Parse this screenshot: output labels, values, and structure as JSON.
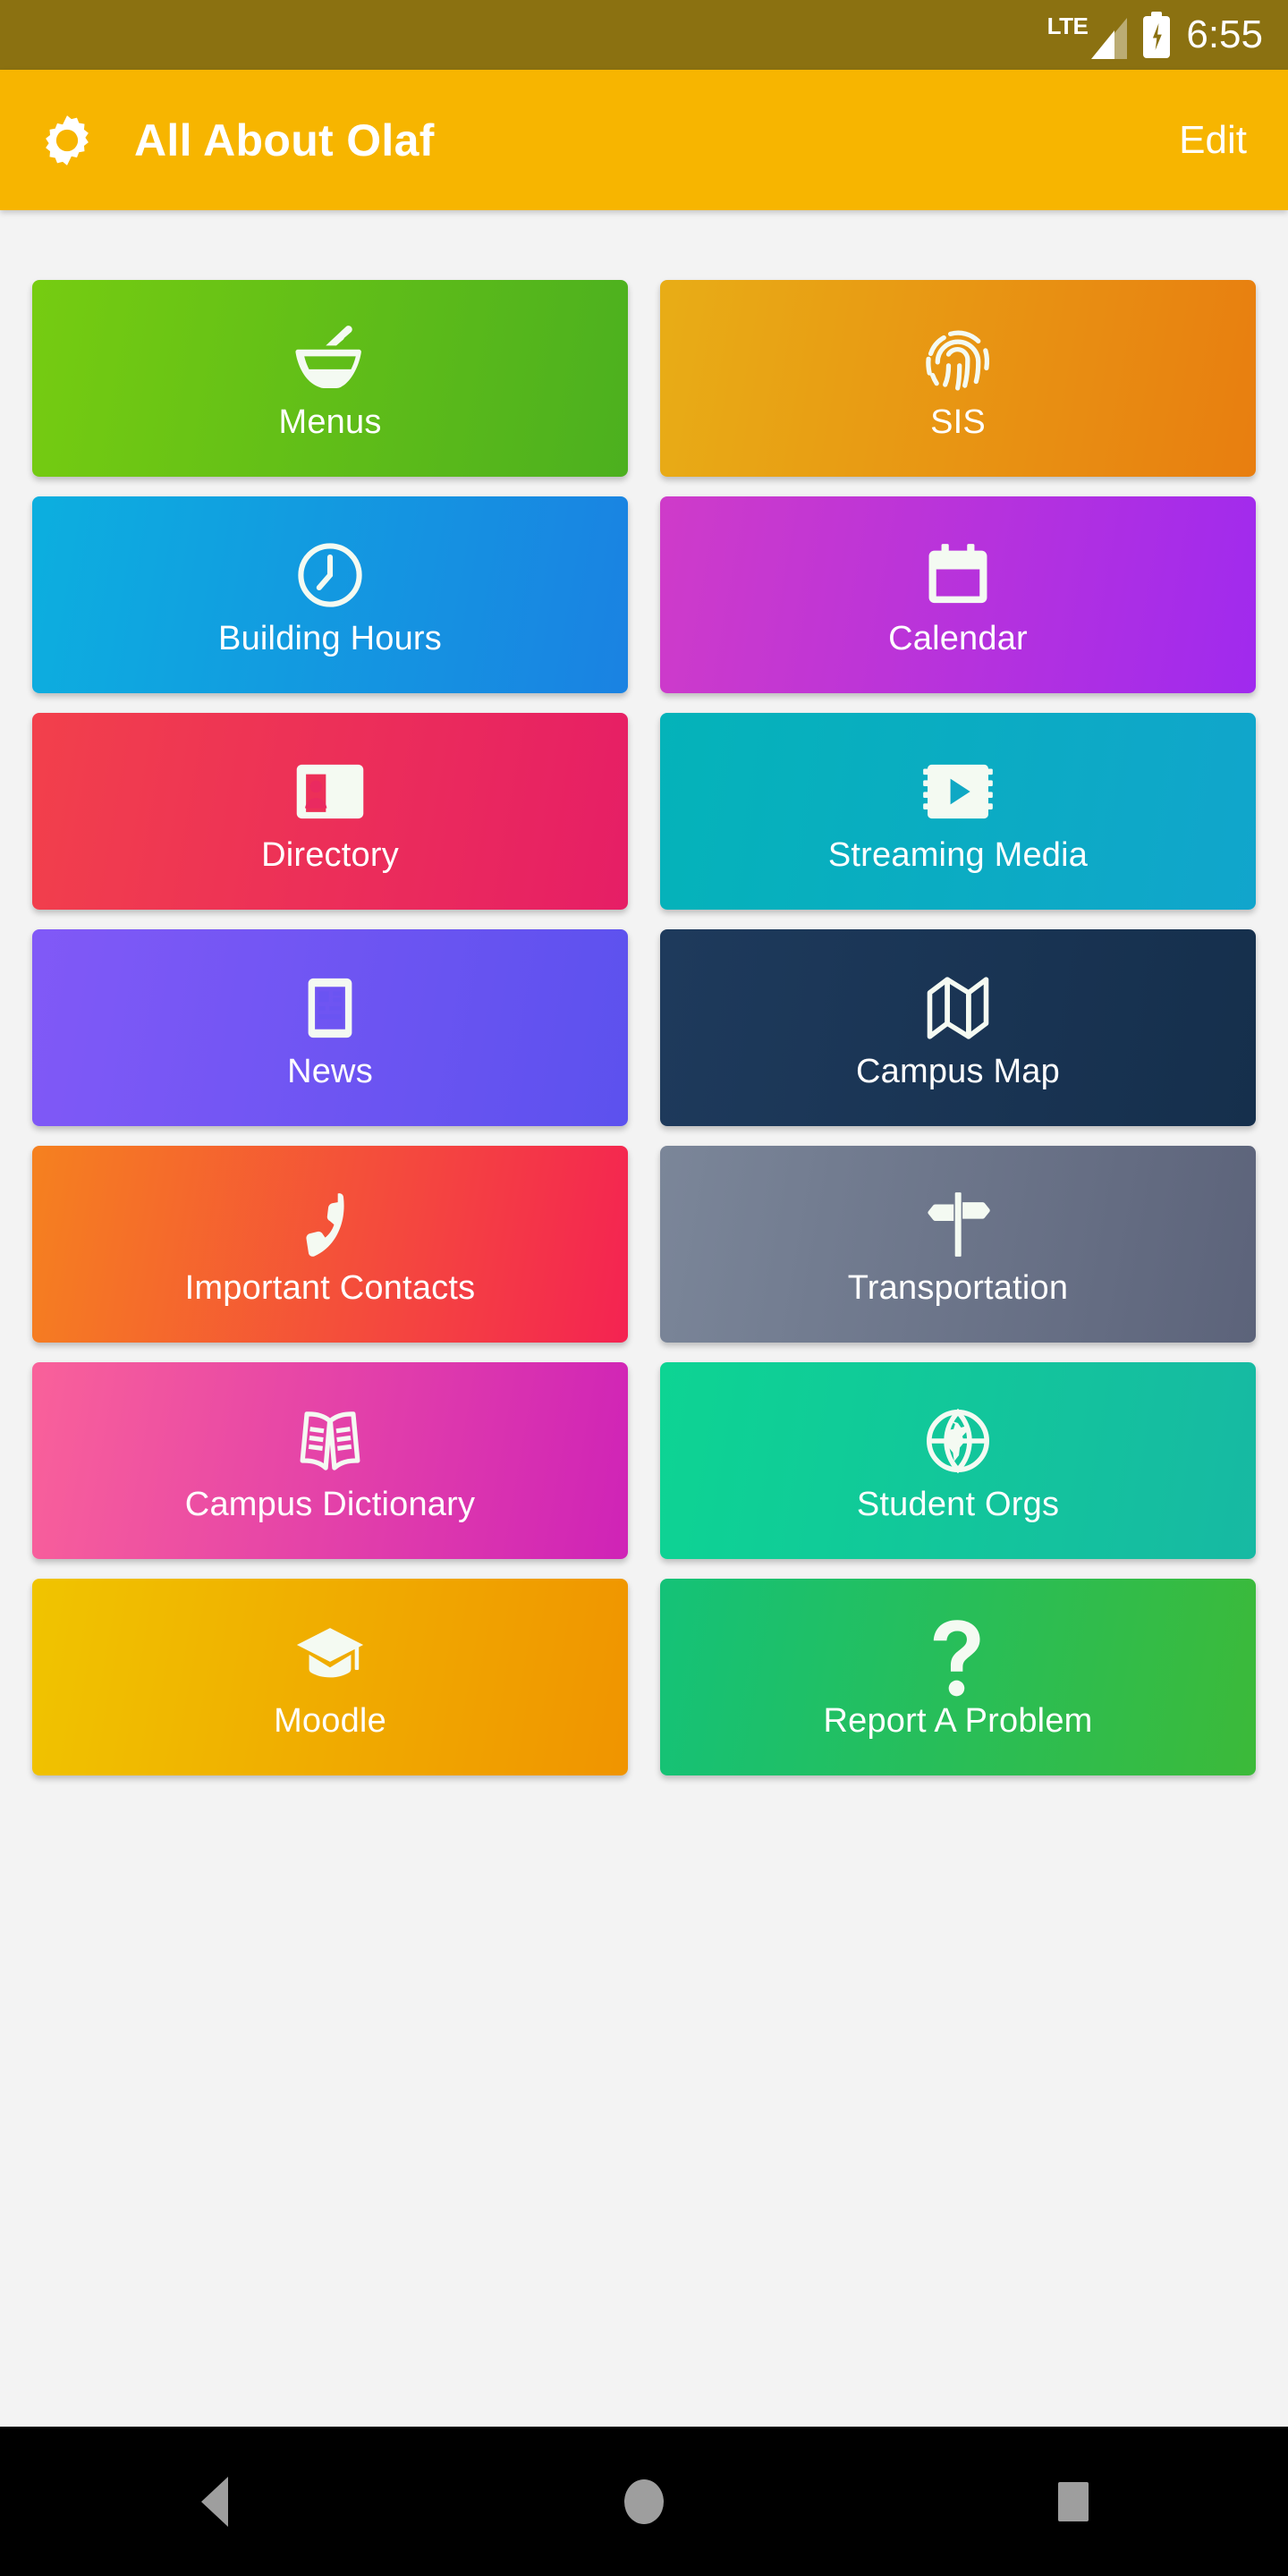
{
  "status_bar": {
    "network_label": "LTE",
    "network_icon": "signal-bars-icon",
    "battery_icon": "battery-charging-icon",
    "time": "6:55",
    "background_color": "#8b7111"
  },
  "app_bar": {
    "settings_icon": "gear-icon",
    "title": "All About Olaf",
    "edit_label": "Edit",
    "background_color": "#f7b500"
  },
  "tiles": [
    {
      "label": "Menus",
      "icon": "mortar-pestle-icon",
      "color_start": "#76cc11",
      "color_end": "#4cb01f"
    },
    {
      "label": "SIS",
      "icon": "fingerprint-icon",
      "color_start": "#e8ad16",
      "color_end": "#e87e10"
    },
    {
      "label": "Building Hours",
      "icon": "clock-icon",
      "color_start": "#0cafdf",
      "color_end": "#1a82e2"
    },
    {
      "label": "Calendar",
      "icon": "calendar-icon",
      "color_start": "#cf3bc9",
      "color_end": "#a02aee"
    },
    {
      "label": "Directory",
      "icon": "contact-card-icon",
      "color_start": "#f2404b",
      "color_end": "#e61e66"
    },
    {
      "label": "Streaming Media",
      "icon": "video-film-icon",
      "color_start": "#04b3b9",
      "color_end": "#11a5cc"
    },
    {
      "label": "News",
      "icon": "newspaper-icon",
      "color_start": "#8159f7",
      "color_end": "#5c51ee"
    },
    {
      "label": "Campus Map",
      "icon": "folded-map-icon",
      "color_start": "#1e3a5c",
      "color_end": "#152f4c"
    },
    {
      "label": "Important Contacts",
      "icon": "phone-icon",
      "color_start": "#f5811f",
      "color_end": "#f42352"
    },
    {
      "label": "Transportation",
      "icon": "signpost-icon",
      "color_start": "#7b8699",
      "color_end": "#5c637a"
    },
    {
      "label": "Campus Dictionary",
      "icon": "open-book-icon",
      "color_start": "#f9619a",
      "color_end": "#cf23b7"
    },
    {
      "label": "Student Orgs",
      "icon": "globe-icon",
      "color_start": "#0dd493",
      "color_end": "#17b9a3"
    },
    {
      "label": "Moodle",
      "icon": "graduation-cap-icon",
      "color_start": "#f0c400",
      "color_end": "#f09400"
    },
    {
      "label": "Report A Problem",
      "icon": "question-mark-icon",
      "color_start": "#14c278",
      "color_end": "#3cba39"
    }
  ],
  "nav_bar": {
    "back_label": "Back",
    "home_label": "Home",
    "recents_label": "Recents",
    "back_icon": "triangle-back-icon",
    "home_icon": "circle-home-icon",
    "recents_icon": "square-recents-icon",
    "background_color": "#000000",
    "icon_color": "#9e9e9e"
  }
}
